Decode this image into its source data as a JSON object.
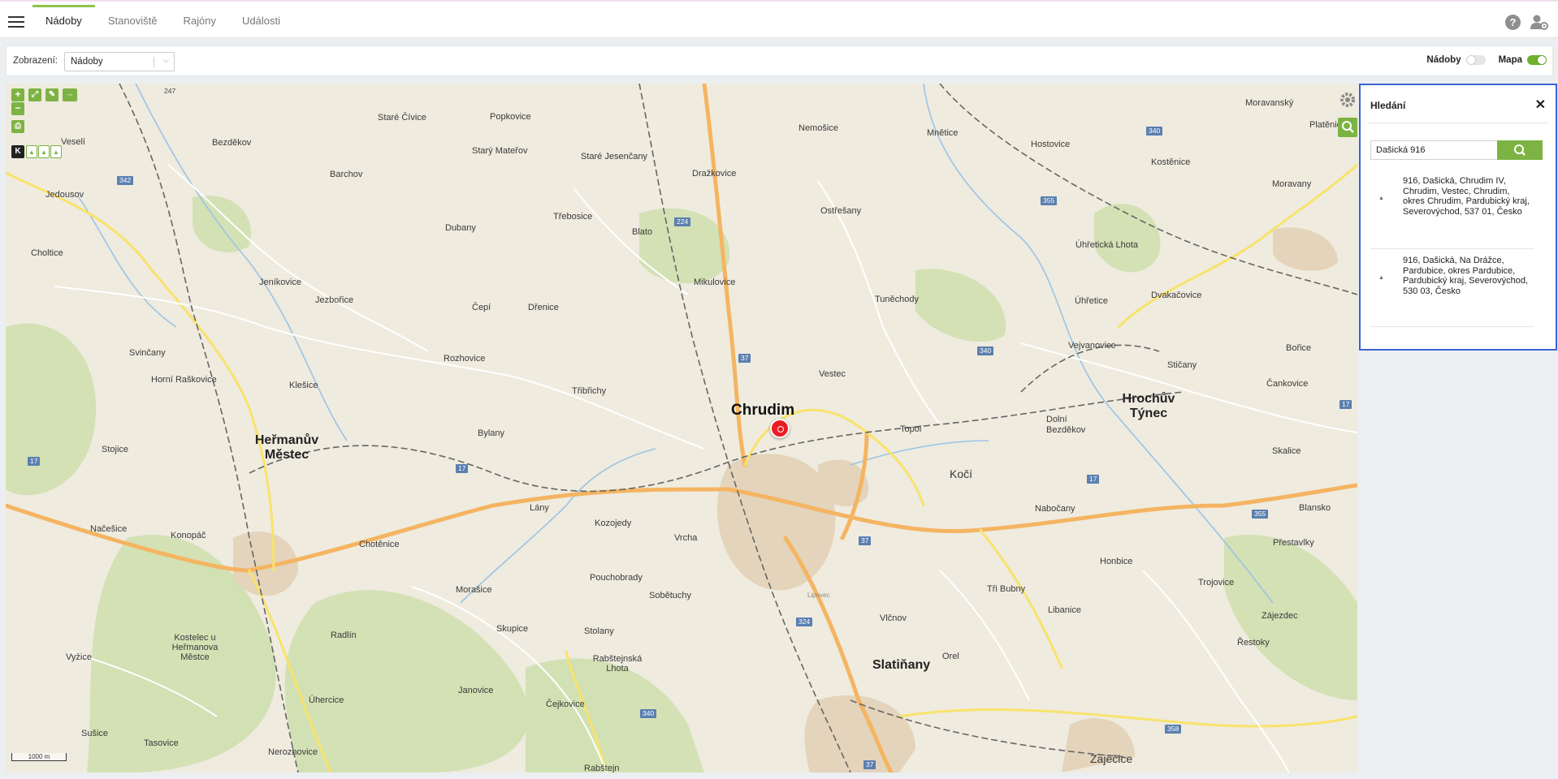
{
  "nav": {
    "tabs": [
      {
        "label": "Nádoby"
      },
      {
        "label": "Stanoviště"
      },
      {
        "label": "Rajóny"
      },
      {
        "label": "Události"
      }
    ],
    "help_glyph": "?"
  },
  "filter": {
    "label": "Zobrazení:",
    "selected": "Nádoby",
    "toggle_nadoby_label": "Nádoby",
    "toggle_mapa_label": "Mapa",
    "toggle_nadoby_on": false,
    "toggle_mapa_on": true
  },
  "map": {
    "scale_label": "1000 m",
    "places_large": [
      {
        "name": "Chrudim"
      },
      {
        "name": "Heřmanův Městec"
      },
      {
        "name": "Hrochův Týnec"
      },
      {
        "name": "Slatiňany"
      }
    ],
    "places": [
      "Veselí",
      "Bezděkov",
      "Staré Čívice",
      "Popkovice",
      "Nemošice",
      "Mněticе",
      "Hostovice",
      "Moravanský",
      "Platěnice",
      "Jedousov",
      "Barchov",
      "Starý Mateřov",
      "Staré Jesenčany",
      "Dražkovice",
      "Kostěnice",
      "Moravany",
      "Choltice",
      "Dubany",
      "Třebosice",
      "Blato",
      "Ostřešany",
      "Úhřetická Lhota",
      "Jeníkovice",
      "Jezbořice",
      "Čepí",
      "Dřenice",
      "Mikulovice",
      "Tuněchody",
      "Úhřetice",
      "Dvakačovice",
      "Svinčany",
      "Horní Raškovice",
      "Rozhovice",
      "Vejvanovice",
      "Bořice",
      "Klešice",
      "Třibřichy",
      "Vestec",
      "Stičany",
      "Čankovice",
      "Bylany",
      "Topol",
      "Dolní Bezděkov",
      "Stojice",
      "Kočí",
      "Skalice",
      "Lány",
      "Načešice",
      "Konopáč",
      "Chotěnice",
      "Nabočany",
      "Blansko",
      "Vrcha",
      "Kozojedy",
      "Přestavlky",
      "Morašice",
      "Pouchobrady",
      "Sobětuchy",
      "Honbice",
      "Trojovice",
      "Lipovec",
      "Tři Bubny",
      "Skupice",
      "Stolany",
      "Libanice",
      "Vlčnov",
      "Zájezdec",
      "Kostelec u Heřmanova Městce",
      "Vyžice",
      "Radlín",
      "Rabštejnská Lhota",
      "Orel",
      "Řestoky",
      "Janovice",
      "Úhercice",
      "Čejkovice",
      "Sušice",
      "Tasovice",
      "Nerozhovice",
      "Zaječice",
      "Rabštejn"
    ],
    "roads": [
      "247",
      "342",
      "17",
      "17",
      "37",
      "37",
      "340",
      "355",
      "340",
      "17",
      "324",
      "340",
      "358",
      "355",
      "17",
      "37",
      "224"
    ]
  },
  "search": {
    "title": "Hledání",
    "close_glyph": "✕",
    "query": "Dašická 916",
    "results": [
      {
        "text": "916, Dašická, Chrudim IV, Chrudim, Vestec, Chrudim, okres Chrudim, Pardubický kraj, Severovýchod, 537 01, Česko"
      },
      {
        "text": "916, Dašická, Na Drážce, Pardubice, okres Pardubice, Pardubický kraj, Severovýchod, 530 03, Česko"
      }
    ]
  }
}
